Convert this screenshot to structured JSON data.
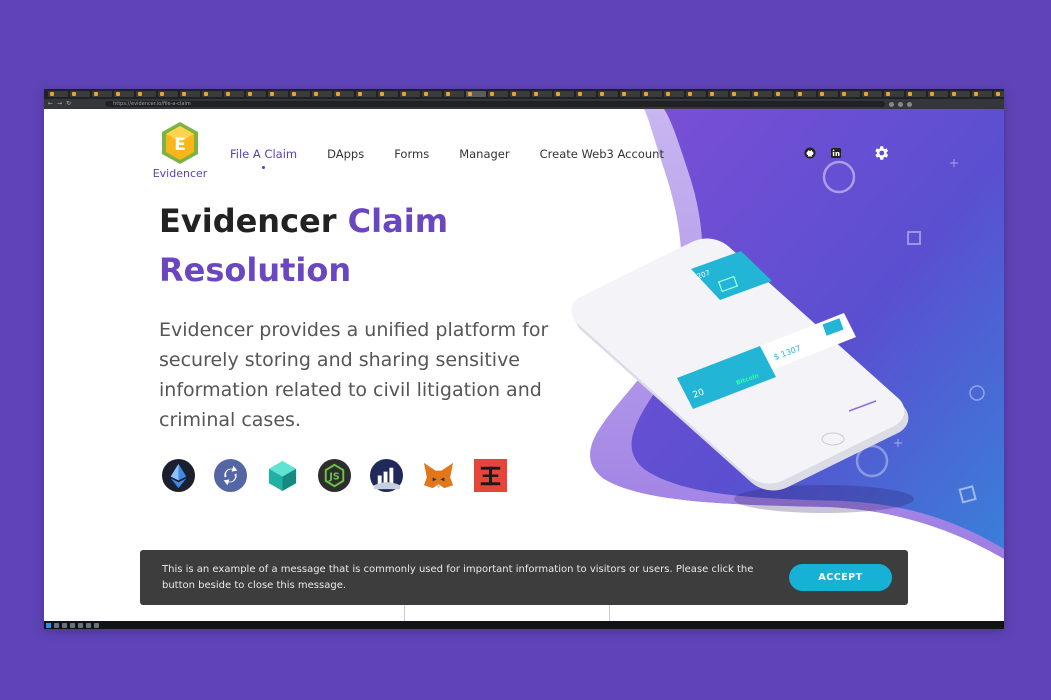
{
  "browser": {
    "url": "https://evidencer.io/file-a-claim",
    "new_tab_symbol": "+",
    "tab_count": 45,
    "active_tab_index": 19
  },
  "header": {
    "logo_letter": "E",
    "logo_text": "Evidencer",
    "nav": [
      {
        "label": "File A Claim",
        "active": true
      },
      {
        "label": "DApps",
        "active": false
      },
      {
        "label": "Forms",
        "active": false
      },
      {
        "label": "Manager",
        "active": false
      },
      {
        "label": "Create Web3 Account",
        "active": false
      }
    ],
    "social_icons": [
      "github-icon",
      "linkedin-icon"
    ],
    "settings_icon": "gear-icon"
  },
  "hero": {
    "title_part1": "Evidencer ",
    "title_part2": "Claim",
    "title_line2": "Resolution",
    "description": "Evidencer provides a unified platform for securely storing and sharing sensitive information related to civil litigation and criminal cases."
  },
  "phone": {
    "card1_value": "207",
    "card2_value": "$ 1307",
    "card3_value": "20",
    "card3_badge": "Bitcoin"
  },
  "tech_icons": [
    "ethereum-icon",
    "swap-icon",
    "cube-icon",
    "nodejs-icon",
    "chart-icon",
    "metamask-icon",
    "tether-icon"
  ],
  "cookie": {
    "message": "This is an example of a message that is commonly used for important information to visitors or users. Please click the button beside to close this message.",
    "accept_label": "ACCEPT"
  },
  "colors": {
    "page_bg": "#5f44b9",
    "brand_purple": "#6b46c1",
    "accept_button": "#17b1d6",
    "teal_card": "#22b5d5"
  }
}
